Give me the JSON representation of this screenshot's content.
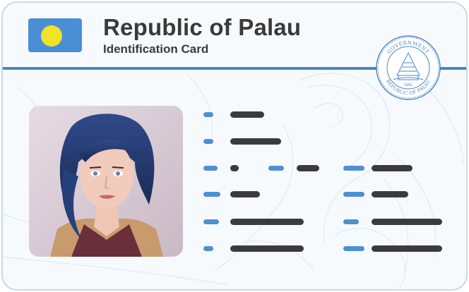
{
  "header": {
    "title": "Republic of Palau",
    "subtitle": "Identification Card"
  },
  "flag": {
    "name": "palau-flag",
    "field_color": "#4a8fd6",
    "moon_color": "#f2e228"
  },
  "seal": {
    "top_text": "GOVERNMENT",
    "bottom_text": "REPUBLIC OF PALAU",
    "year": "1981"
  },
  "colors": {
    "accent_blue": "#4a86c5",
    "redacted_value": "#3b3b3d",
    "card_border": "#c9d8ea"
  },
  "photo": {
    "description_icon": "portrait-photo"
  },
  "fields_note": "all field labels and values are redacted as bars"
}
